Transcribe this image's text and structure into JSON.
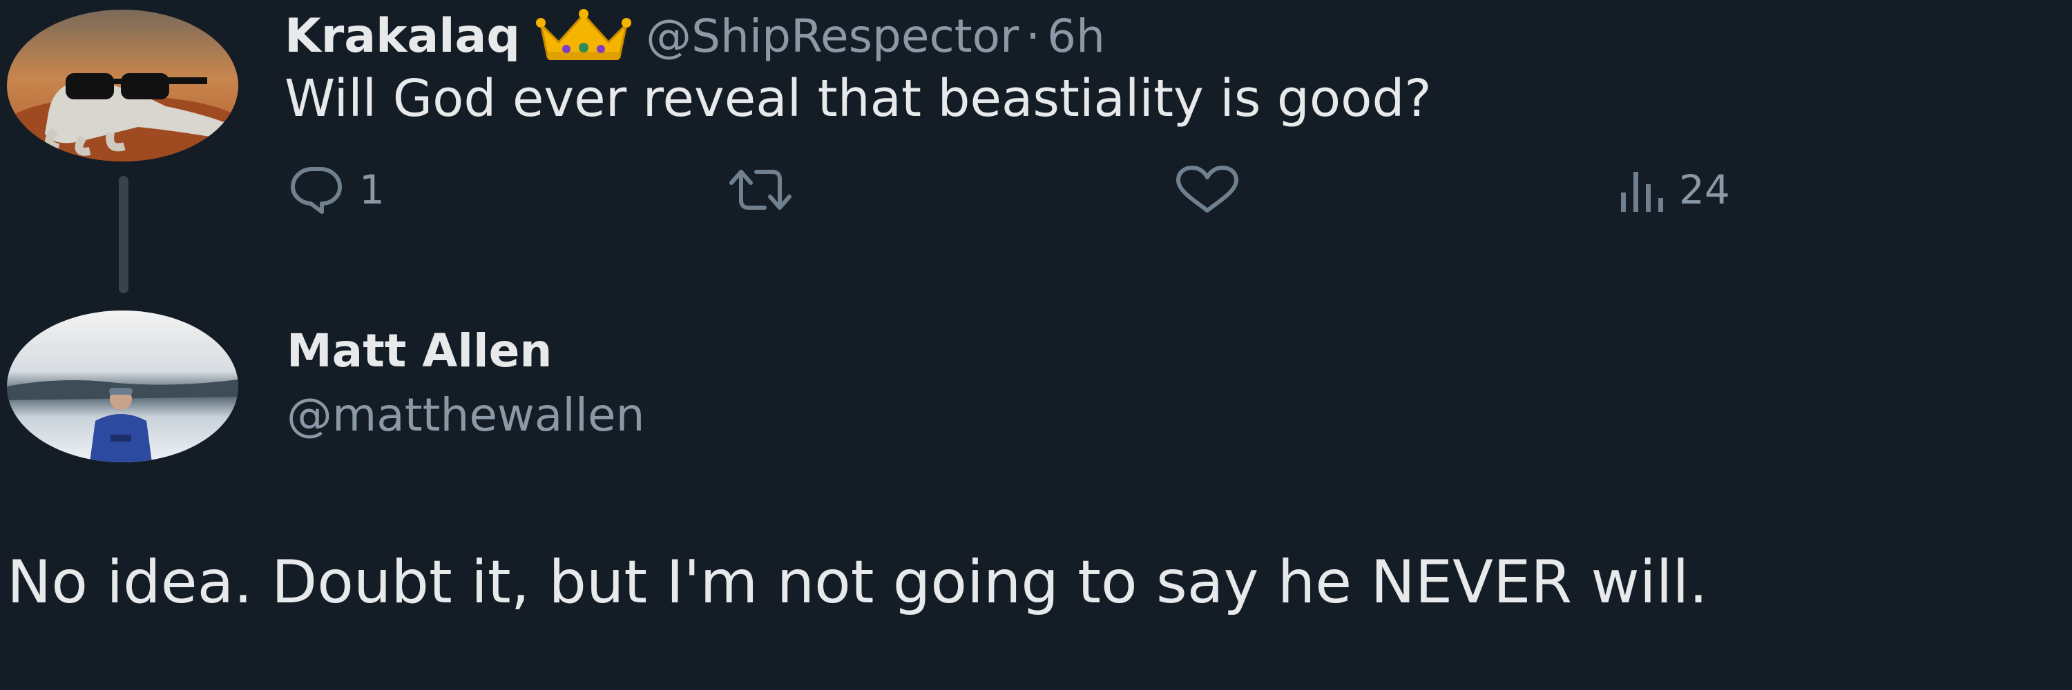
{
  "tweet1": {
    "display_name": "Krakalaq",
    "badge_icon": "crown-emoji",
    "handle": "@ShipRespector",
    "separator": "·",
    "time": "6h",
    "text": "Will God ever reveal that beastiality is good?",
    "actions": {
      "reply_count": "1",
      "views_count": "24"
    }
  },
  "tweet2": {
    "display_name": "Matt Allen",
    "handle": "@matthewallen",
    "text": "No idea. Doubt it, but I'm not going to say he NEVER will."
  },
  "colors": {
    "background": "#141d26",
    "primary_text": "#e7e9ea",
    "secondary_text": "#8b98a5",
    "thread_line": "#38444d"
  }
}
